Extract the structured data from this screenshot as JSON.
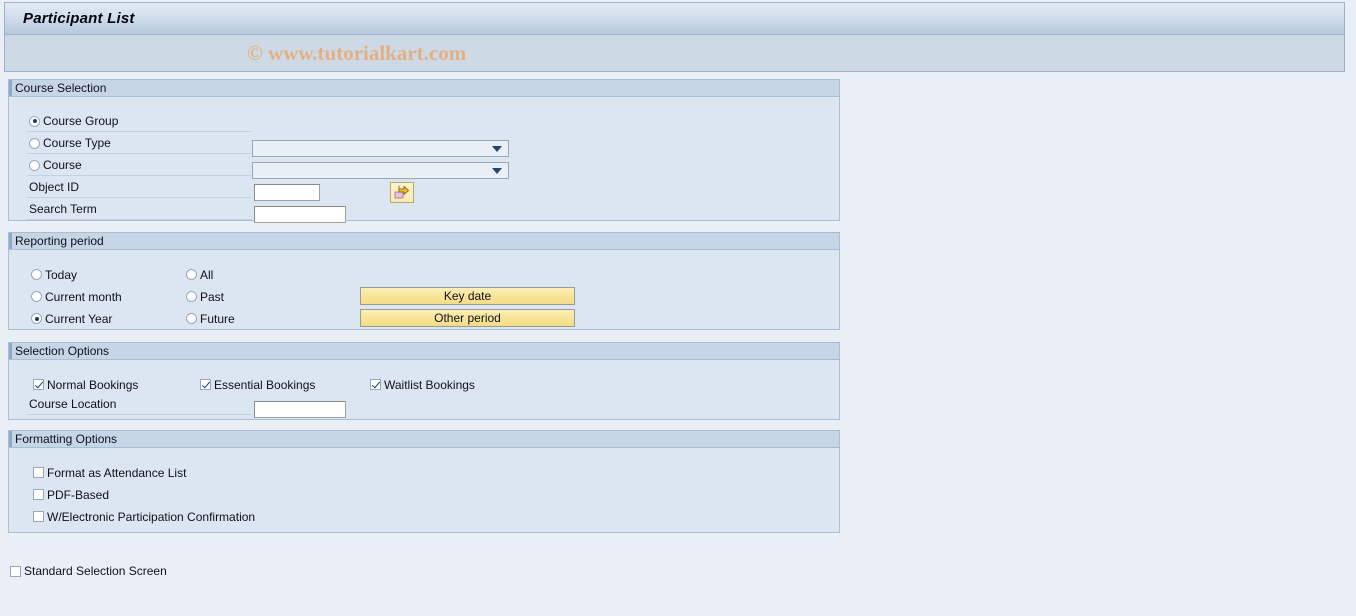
{
  "window": {
    "title": "Participant List",
    "watermark": "© www.tutorialkart.com"
  },
  "course_selection": {
    "title": "Course Selection",
    "radio_group_name": "course-scope",
    "options": [
      {
        "label": "Course Group",
        "selected": true
      },
      {
        "label": "Course Type",
        "selected": false
      },
      {
        "label": "Course",
        "selected": false
      }
    ],
    "course_type_dropdown": {
      "value": "",
      "placeholder": ""
    },
    "course_dropdown": {
      "value": "",
      "placeholder": ""
    },
    "object_id": {
      "label": "Object ID",
      "value": "",
      "placeholder": ""
    },
    "search_term": {
      "label": "Search Term",
      "value": "",
      "placeholder": ""
    },
    "navigate_icon": "arrow-right-icon"
  },
  "reporting_period": {
    "title": "Reporting period",
    "options_left": [
      {
        "label": "Today",
        "selected": false
      },
      {
        "label": "Current month",
        "selected": false
      },
      {
        "label": "Current Year",
        "selected": true
      }
    ],
    "options_right": [
      {
        "label": "All",
        "selected": false
      },
      {
        "label": "Past",
        "selected": false
      },
      {
        "label": "Future",
        "selected": false
      }
    ],
    "buttons": [
      {
        "label": "Key date"
      },
      {
        "label": "Other period"
      }
    ]
  },
  "selection_options": {
    "title": "Selection Options",
    "checkboxes": [
      {
        "label": "Normal Bookings",
        "checked": true
      },
      {
        "label": "Essential Bookings",
        "checked": true
      },
      {
        "label": "Waitlist Bookings",
        "checked": true
      }
    ],
    "course_location": {
      "label": "Course Location",
      "value": "",
      "placeholder": ""
    }
  },
  "formatting_options": {
    "title": "Formatting Options",
    "checkboxes": [
      {
        "label": "Format as Attendance List",
        "checked": false
      },
      {
        "label": "PDF-Based",
        "checked": false
      },
      {
        "label": "W/Electronic Participation Confirmation",
        "checked": false
      }
    ]
  },
  "footer": {
    "standard_selection_screen": {
      "label": "Standard Selection Screen",
      "checked": false
    }
  },
  "colors": {
    "panel_bg": "#dce6f0",
    "panel_head_bg": "#c6d6e6",
    "page_bg": "#eaeff5",
    "button_yellow": "#f7e395",
    "watermark": "#e3b083",
    "accent_dark": "#1f3a5f"
  }
}
